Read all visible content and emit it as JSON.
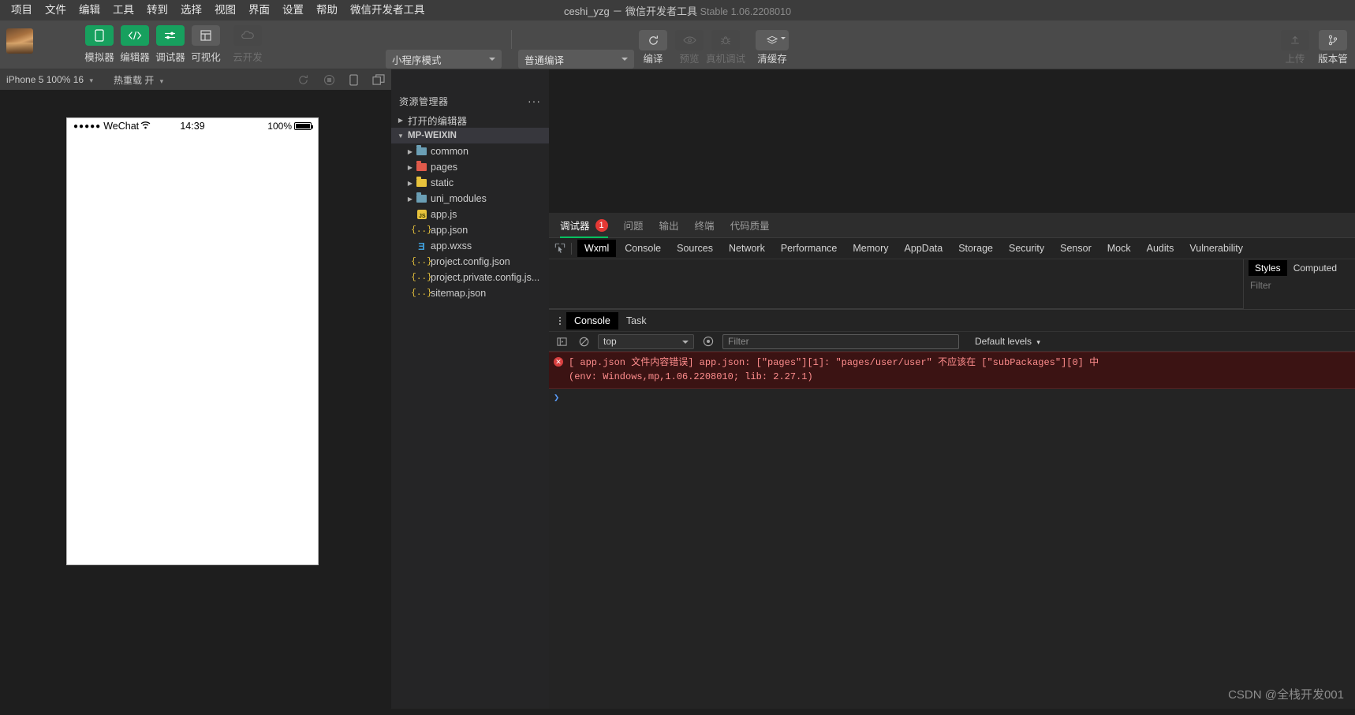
{
  "window": {
    "title_project": "ceshi_yzg",
    "title_sep": "－",
    "title_app": "微信开发者工具",
    "title_version": "Stable 1.06.2208010"
  },
  "menubar": {
    "items": [
      {
        "label": "项目"
      },
      {
        "label": "文件"
      },
      {
        "label": "编辑"
      },
      {
        "label": "工具"
      },
      {
        "label": "转到"
      },
      {
        "label": "选择"
      },
      {
        "label": "视图"
      },
      {
        "label": "界面"
      },
      {
        "label": "设置"
      },
      {
        "label": "帮助"
      },
      {
        "label": "微信开发者工具"
      }
    ]
  },
  "toolbar": {
    "left_buttons": [
      {
        "label": "模拟器",
        "icon": "phone-icon",
        "state": "active"
      },
      {
        "label": "编辑器",
        "icon": "code-icon",
        "state": "active"
      },
      {
        "label": "调试器",
        "icon": "sliders-icon",
        "state": "active"
      },
      {
        "label": "可视化",
        "icon": "layout-icon",
        "state": "inactive"
      },
      {
        "label": "云开发",
        "icon": "cloud-icon",
        "state": "disabled"
      }
    ],
    "mode_select": "小程序模式",
    "compile_select": "普通编译",
    "action_buttons": [
      {
        "label": "编译",
        "icon": "refresh-icon",
        "state": "active"
      },
      {
        "label": "预览",
        "icon": "eye-icon",
        "state": "disabled"
      },
      {
        "label": "真机调试",
        "icon": "bug-icon",
        "state": "disabled"
      },
      {
        "label": "清缓存",
        "icon": "layers-icon",
        "state": "active"
      }
    ],
    "right_buttons": [
      {
        "label": "上传",
        "icon": "upload-icon",
        "state": "disabled"
      },
      {
        "label": "版本管",
        "icon": "branch-icon",
        "state": "active"
      }
    ]
  },
  "simulator": {
    "device_select": "iPhone 5 100% 16",
    "hotreload_label": "热重载 开",
    "icons": [
      {
        "name": "rotate-icon",
        "state": "disabled"
      },
      {
        "name": "record-icon",
        "state": "disabled"
      },
      {
        "name": "device-icon",
        "state": "enabled"
      },
      {
        "name": "detach-icon",
        "state": "enabled"
      }
    ],
    "phone": {
      "signal_dots": "●●●●●",
      "carrier": "WeChat",
      "time": "14:39",
      "battery_percent": "100%"
    }
  },
  "activitybar": {
    "icons": [
      {
        "name": "files-icon",
        "active": true
      },
      {
        "name": "search-icon",
        "active": false
      },
      {
        "name": "source-control-icon",
        "active": false
      },
      {
        "name": "extensions-icon",
        "active": false
      },
      {
        "name": "components-icon",
        "active": false
      },
      {
        "name": "cloud-dev-icon",
        "active": false
      }
    ]
  },
  "explorer": {
    "title": "资源管理器",
    "more_label": "···",
    "sections": [
      {
        "label": "打开的编辑器",
        "expanded": false,
        "indent": 0,
        "kind": "section"
      },
      {
        "label": "MP-WEIXIN",
        "expanded": true,
        "indent": 0,
        "kind": "root",
        "selected": true
      }
    ],
    "files": [
      {
        "label": "common",
        "kind": "folder",
        "color": "#6b9fb5",
        "indent": 1,
        "expandable": true
      },
      {
        "label": "pages",
        "kind": "folder",
        "color": "#e05a4b",
        "indent": 1,
        "expandable": true
      },
      {
        "label": "static",
        "kind": "folder",
        "color": "#e8c33c",
        "indent": 1,
        "expandable": true
      },
      {
        "label": "uni_modules",
        "kind": "folder",
        "color": "#6b9fb5",
        "indent": 1,
        "expandable": true
      },
      {
        "label": "app.js",
        "kind": "js",
        "indent": 1,
        "expandable": false
      },
      {
        "label": "app.json",
        "kind": "json",
        "indent": 1,
        "expandable": false
      },
      {
        "label": "app.wxss",
        "kind": "css",
        "indent": 1,
        "expandable": false
      },
      {
        "label": "project.config.json",
        "kind": "json",
        "indent": 1,
        "expandable": false
      },
      {
        "label": "project.private.config.js...",
        "kind": "json",
        "indent": 1,
        "expandable": false
      },
      {
        "label": "sitemap.json",
        "kind": "json",
        "indent": 1,
        "expandable": false
      }
    ]
  },
  "devtools": {
    "outer_tabs": [
      {
        "label": "调试器",
        "badge": "1",
        "active": true
      },
      {
        "label": "问题",
        "badge": "",
        "active": false
      },
      {
        "label": "输出",
        "badge": "",
        "active": false
      },
      {
        "label": "终端",
        "badge": "",
        "active": false
      },
      {
        "label": "代码质量",
        "badge": "",
        "active": false
      }
    ],
    "panel_tabs": [
      {
        "label": "Wxml",
        "active": true
      },
      {
        "label": "Console",
        "active": false
      },
      {
        "label": "Sources",
        "active": false
      },
      {
        "label": "Network",
        "active": false
      },
      {
        "label": "Performance",
        "active": false
      },
      {
        "label": "Memory",
        "active": false
      },
      {
        "label": "AppData",
        "active": false
      },
      {
        "label": "Storage",
        "active": false
      },
      {
        "label": "Security",
        "active": false
      },
      {
        "label": "Sensor",
        "active": false
      },
      {
        "label": "Mock",
        "active": false
      },
      {
        "label": "Audits",
        "active": false
      },
      {
        "label": "Vulnerability",
        "active": false
      }
    ],
    "styles_pane": {
      "tabs": [
        {
          "label": "Styles",
          "active": true
        },
        {
          "label": "Computed",
          "active": false
        }
      ],
      "filter_placeholder": "Filter"
    },
    "console": {
      "tabs": [
        {
          "label": "Console",
          "active": true
        },
        {
          "label": "Task",
          "active": false
        }
      ],
      "context": "top",
      "filter_placeholder": "Filter",
      "levels_label": "Default levels",
      "messages": [
        {
          "type": "error",
          "line1": "[ app.json 文件内容错误] app.json: [\"pages\"][1]: \"pages/user/user\" 不应该在 [\"subPackages\"][0] 中",
          "line2": "(env: Windows,mp,1.06.2208010; lib: 2.27.1)"
        }
      ],
      "prompt": "❯"
    }
  },
  "watermark": "CSDN @全栈开发001",
  "colors": {
    "accent_green": "#07c160",
    "error_red": "#e53935",
    "titlebar": "#3c3c3c",
    "toolbar": "#4a4a4a"
  }
}
